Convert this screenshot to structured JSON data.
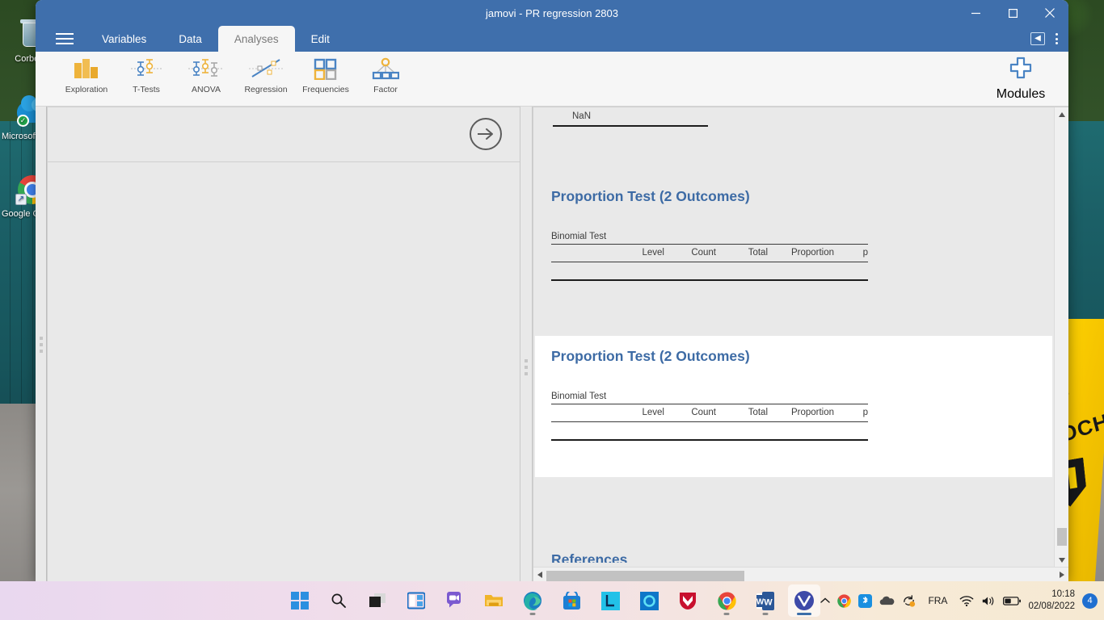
{
  "window": {
    "title": "jamovi - PR regression 2803",
    "minimize_label": "–",
    "maximize_label": "❑",
    "close_label": "✕"
  },
  "menubar": {
    "hamburger_label": "",
    "tabs": [
      {
        "label": "Variables",
        "active": false
      },
      {
        "label": "Data",
        "active": false
      },
      {
        "label": "Analyses",
        "active": true
      },
      {
        "label": "Edit",
        "active": false
      }
    ],
    "panel_toggle_label": "◀",
    "kebab_label": ""
  },
  "ribbon": {
    "buttons": [
      {
        "label": "Exploration",
        "icon": "bar-chart-icon"
      },
      {
        "label": "T-Tests",
        "icon": "ttest-icon"
      },
      {
        "label": "ANOVA",
        "icon": "anova-icon"
      },
      {
        "label": "Regression",
        "icon": "regression-icon"
      },
      {
        "label": "Frequencies",
        "icon": "frequencies-icon"
      },
      {
        "label": "Factor",
        "icon": "factor-icon"
      }
    ],
    "modules": {
      "label": "Modules",
      "icon": "plus-icon"
    }
  },
  "options_panel": {
    "forward_arrow_label": "→"
  },
  "results": {
    "nan_value": "NaN",
    "analyses": [
      {
        "title": "Proportion Test (2 Outcomes)",
        "table_caption": "Binomial Test",
        "columns": [
          "",
          "Level",
          "Count",
          "Total",
          "Proportion",
          "p"
        ],
        "rows": [],
        "selected": false
      },
      {
        "title": "Proportion Test (2 Outcomes)",
        "table_caption": "Binomial Test",
        "columns": [
          "",
          "Level",
          "Count",
          "Total",
          "Proportion",
          "p"
        ],
        "rows": [],
        "selected": true
      }
    ],
    "references_title": "References",
    "scroll": {
      "up_arrow": "▲",
      "down_arrow": "▼",
      "left_arrow": "◀",
      "right_arrow": "▶"
    }
  },
  "desktop": {
    "icons": [
      {
        "label": "Corbeille",
        "icon": "recycle-bin-icon"
      },
      {
        "label": "Microsoft OneDrive",
        "icon": "onedrive-icon"
      },
      {
        "label": "Google Chrome",
        "icon": "chrome-icon"
      }
    ],
    "wallpaper_text": "ROCHE"
  },
  "taskbar": {
    "apps": [
      {
        "name": "start-button",
        "label": "Start"
      },
      {
        "name": "search-button",
        "label": "Search"
      },
      {
        "name": "task-view-button",
        "label": "Task View"
      },
      {
        "name": "widgets-button",
        "label": "Widgets"
      },
      {
        "name": "teams-chat-button",
        "label": "Chat"
      },
      {
        "name": "file-explorer-button",
        "label": "File Explorer"
      },
      {
        "name": "edge-button",
        "label": "Microsoft Edge"
      },
      {
        "name": "microsoft-store-button",
        "label": "Microsoft Store"
      },
      {
        "name": "lexibar-button",
        "label": "L"
      },
      {
        "name": "blue-circle-app-button",
        "label": "App"
      },
      {
        "name": "mcafee-button",
        "label": "McAfee"
      },
      {
        "name": "chrome-button",
        "label": "Google Chrome"
      },
      {
        "name": "word-button",
        "label": "Microsoft Word"
      },
      {
        "name": "jamovi-button",
        "label": "jamovi"
      }
    ],
    "tray": {
      "chevron": "∧",
      "language": "FRA",
      "time": "10:18",
      "date": "02/08/2022",
      "notification_count": "4"
    }
  }
}
